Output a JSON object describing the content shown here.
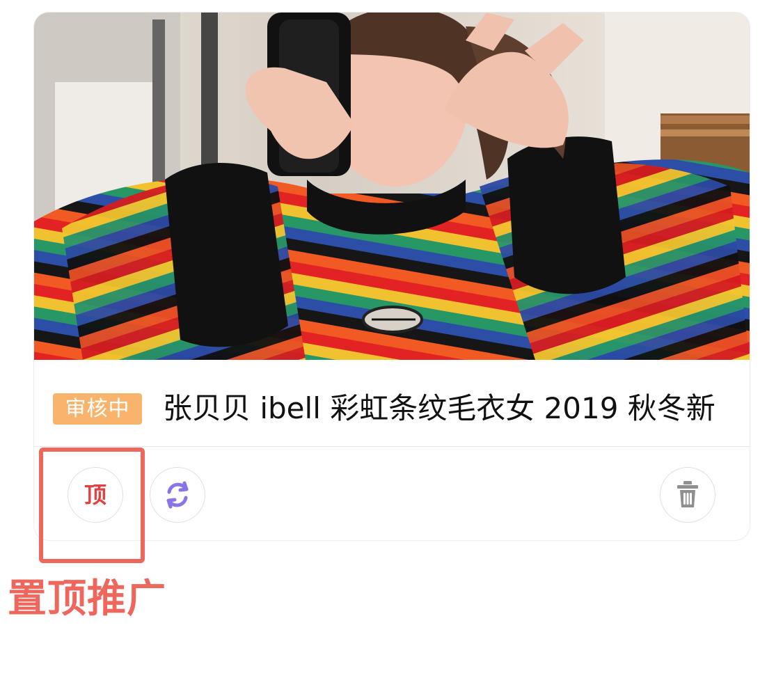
{
  "card": {
    "status_badge": "审核中",
    "title": "张贝贝 ibell 彩虹条纹毛衣女 2019 秋冬新"
  },
  "actions": {
    "top_label": "顶",
    "refresh_icon": "refresh-icon",
    "delete_icon": "trash-icon"
  },
  "annotation": {
    "label": "置顶推广"
  },
  "colors": {
    "badge": "#f8b46c",
    "top_text": "#e34141",
    "refresh": "#8b73e8",
    "trash": "#8f8f8f",
    "annotation": "#ee675c"
  }
}
